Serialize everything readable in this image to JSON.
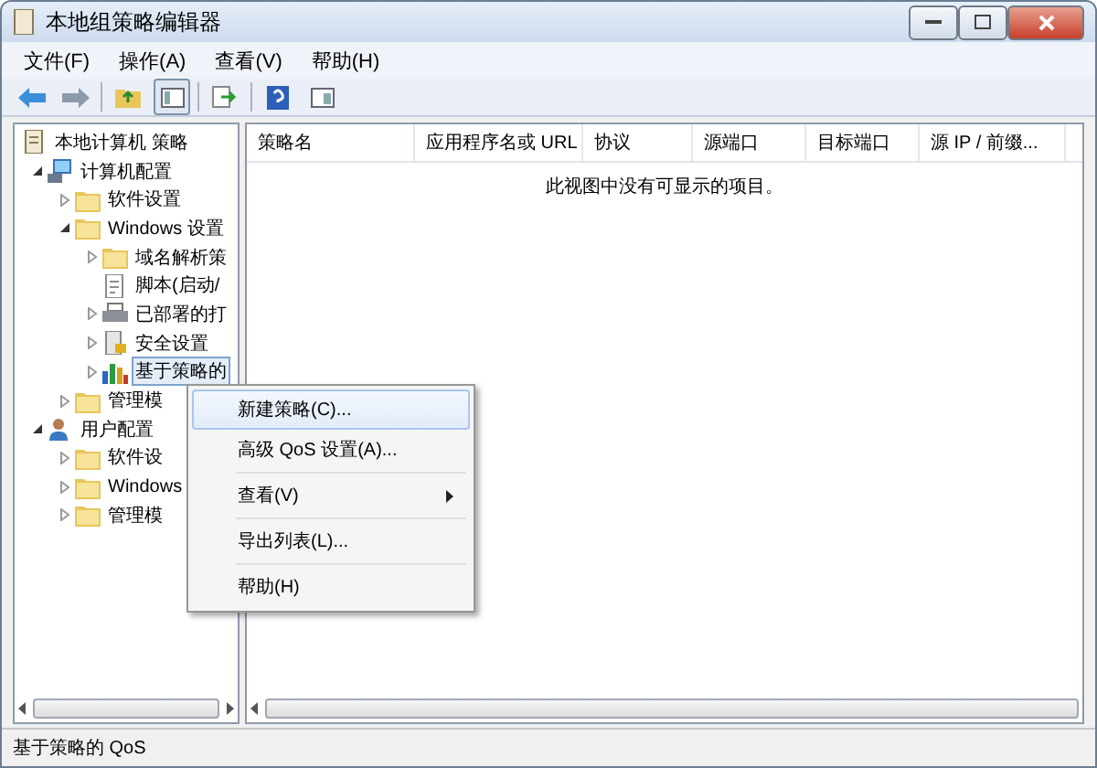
{
  "window": {
    "title": "本地组策略编辑器"
  },
  "menu": [
    "文件(F)",
    "操作(A)",
    "查看(V)",
    "帮助(H)"
  ],
  "tree": [
    {
      "label": "本地计算机 策略",
      "kind": "doc",
      "selected": false,
      "children": [
        {
          "label": "计算机配置",
          "kind": "computer",
          "expanded": true,
          "selected": false,
          "children": [
            {
              "label": "软件设置",
              "kind": "folder",
              "expanded": false,
              "selected": false
            },
            {
              "label": "Windows 设置",
              "kind": "folder",
              "expanded": true,
              "selected": false,
              "children": [
                {
                  "label": "域名解析策",
                  "kind": "folder",
                  "expanded": false,
                  "selected": false
                },
                {
                  "label": "脚本(启动/",
                  "kind": "script",
                  "selected": false
                },
                {
                  "label": "已部署的打",
                  "kind": "printer",
                  "expanded": false,
                  "selected": false
                },
                {
                  "label": "安全设置",
                  "kind": "security",
                  "expanded": false,
                  "selected": false
                },
                {
                  "label": "基于策略的",
                  "kind": "chart",
                  "expanded": false,
                  "selected": true
                }
              ]
            },
            {
              "label": "管理模",
              "kind": "folder",
              "expanded": false,
              "selected": false
            }
          ]
        },
        {
          "label": "用户配置",
          "kind": "user",
          "expanded": true,
          "selected": false,
          "children": [
            {
              "label": "软件设",
              "kind": "folder",
              "expanded": false,
              "selected": false
            },
            {
              "label": "Windows",
              "kind": "folder",
              "expanded": false,
              "selected": false
            },
            {
              "label": "管理模",
              "kind": "folder",
              "expanded": false,
              "selected": false
            }
          ]
        }
      ]
    }
  ],
  "table": {
    "columns": [
      "策略名",
      "应用程序名或 URL",
      "协议",
      "源端口",
      "目标端口",
      "源 IP / 前缀..."
    ],
    "empty_message": "此视图中没有可显示的项目。"
  },
  "context_menu": [
    {
      "label": "新建策略(C)...",
      "selected": true,
      "submenu": false,
      "separator_after": false
    },
    {
      "label": "高级 QoS 设置(A)...",
      "selected": false,
      "submenu": false,
      "separator_after": true
    },
    {
      "label": "查看(V)",
      "selected": false,
      "submenu": true,
      "separator_after": true
    },
    {
      "label": "导出列表(L)...",
      "selected": false,
      "submenu": false,
      "separator_after": true
    },
    {
      "label": "帮助(H)",
      "selected": false,
      "submenu": false,
      "separator_after": false
    }
  ],
  "status_bar": "基于策略的 QoS"
}
